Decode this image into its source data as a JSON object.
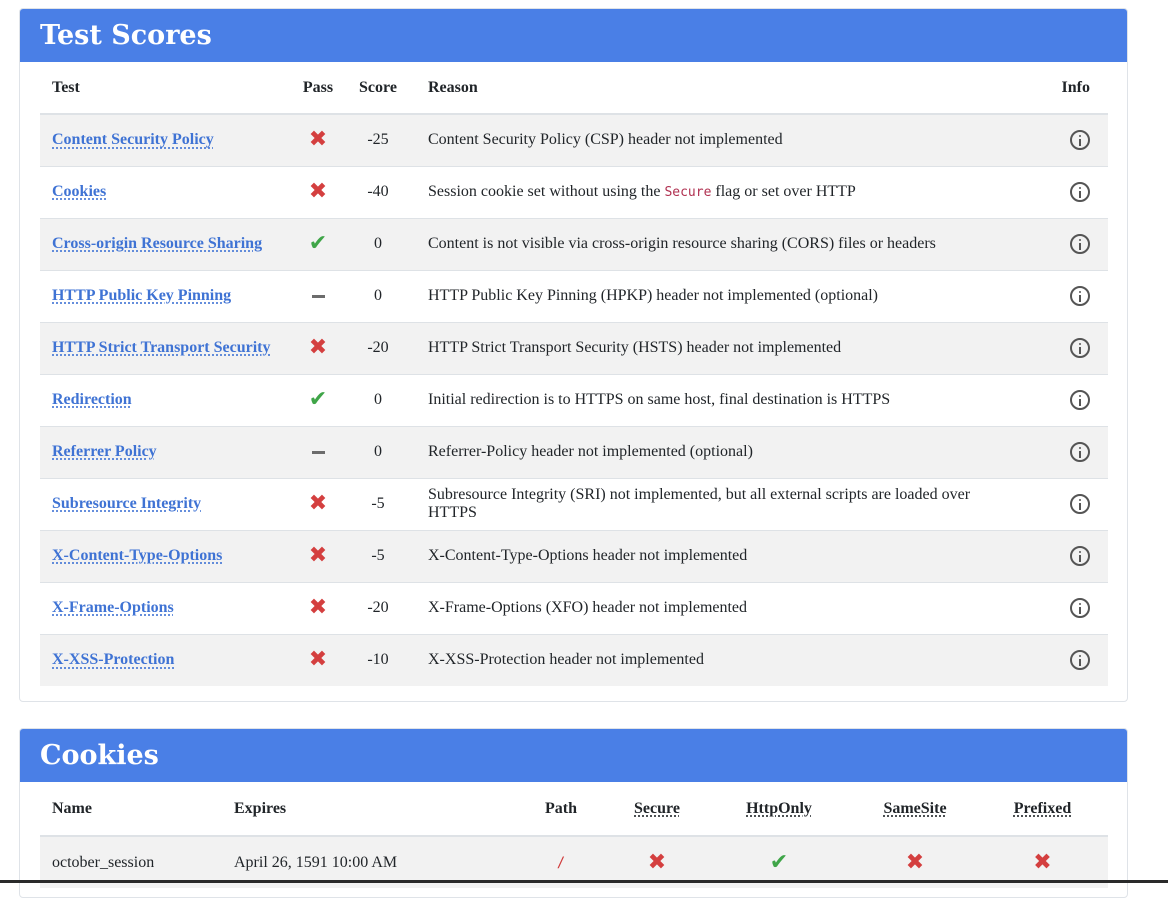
{
  "test_scores": {
    "title": "Test Scores",
    "columns": {
      "test": "Test",
      "pass": "Pass",
      "score": "Score",
      "reason": "Reason",
      "info": "Info"
    },
    "rows": [
      {
        "test": "Content Security Policy",
        "pass": "fail",
        "score": "-25",
        "reason": "Content Security Policy (CSP) header not implemented"
      },
      {
        "test": "Cookies",
        "pass": "fail",
        "score": "-40",
        "reason_before": "Session cookie set without using the ",
        "reason_code": "Secure",
        "reason_after": " flag or set over HTTP"
      },
      {
        "test": "Cross-origin Resource Sharing",
        "pass": "pass",
        "score": "0",
        "reason": "Content is not visible via cross-origin resource sharing (CORS) files or headers"
      },
      {
        "test": "HTTP Public Key Pinning",
        "pass": "neutral",
        "score": "0",
        "reason": "HTTP Public Key Pinning (HPKP) header not implemented (optional)"
      },
      {
        "test": "HTTP Strict Transport Security",
        "pass": "fail",
        "score": "-20",
        "reason": "HTTP Strict Transport Security (HSTS) header not implemented"
      },
      {
        "test": "Redirection",
        "pass": "pass",
        "score": "0",
        "reason": "Initial redirection is to HTTPS on same host, final destination is HTTPS"
      },
      {
        "test": "Referrer Policy",
        "pass": "neutral",
        "score": "0",
        "reason": "Referrer-Policy header not implemented (optional)"
      },
      {
        "test": "Subresource Integrity",
        "pass": "fail",
        "score": "-5",
        "reason": "Subresource Integrity (SRI) not implemented, but all external scripts are loaded over HTTPS"
      },
      {
        "test": "X-Content-Type-Options",
        "pass": "fail",
        "score": "-5",
        "reason": "X-Content-Type-Options header not implemented"
      },
      {
        "test": "X-Frame-Options",
        "pass": "fail",
        "score": "-20",
        "reason": "X-Frame-Options (XFO) header not implemented"
      },
      {
        "test": "X-XSS-Protection",
        "pass": "fail",
        "score": "-10",
        "reason": "X-XSS-Protection header not implemented"
      }
    ]
  },
  "cookies": {
    "title": "Cookies",
    "columns": {
      "name": "Name",
      "expires": "Expires",
      "path": "Path",
      "secure": "Secure",
      "httponly": "HttpOnly",
      "samesite": "SameSite",
      "prefixed": "Prefixed"
    },
    "rows": [
      {
        "name": "october_session",
        "expires": "April 26, 1591 10:00 AM",
        "path": "/",
        "secure": "fail",
        "httponly": "pass",
        "samesite": "fail",
        "prefixed": "fail"
      }
    ]
  },
  "icons": {
    "fail": "x-mark-icon",
    "pass": "check-mark-icon",
    "neutral": "dash-icon",
    "info": "info-icon"
  },
  "colors": {
    "header_bg": "#4a7fe6",
    "link": "#3f73d4",
    "fail": "#d43f3f",
    "pass": "#3fa548",
    "neutral": "#6c6c6c",
    "row_stripe": "#f2f2f2"
  }
}
